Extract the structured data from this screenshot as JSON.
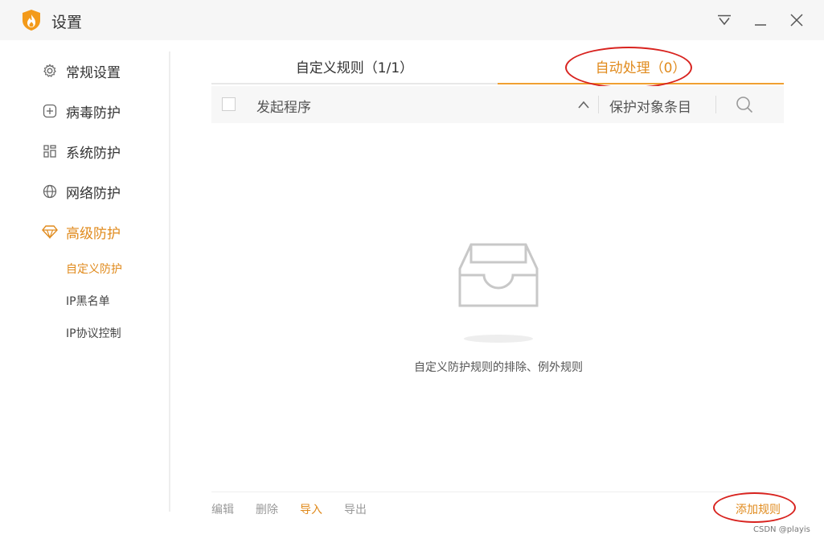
{
  "window": {
    "title": "设置",
    "logo_icon": "fire-shield-icon",
    "controls": [
      "dropdown-menu-icon",
      "minimize-icon",
      "close-icon"
    ]
  },
  "sidebar": {
    "items": [
      {
        "label": "常规设置",
        "icon": "gear-icon"
      },
      {
        "label": "病毒防护",
        "icon": "plus-square-icon"
      },
      {
        "label": "系统防护",
        "icon": "grid-icon"
      },
      {
        "label": "网络防护",
        "icon": "globe-icon"
      },
      {
        "label": "高级防护",
        "icon": "diamond-icon",
        "active": true
      }
    ],
    "sub_items": [
      {
        "label": "自定义防护",
        "active": true
      },
      {
        "label": "IP黑名单"
      },
      {
        "label": "IP协议控制"
      }
    ]
  },
  "tabs": [
    {
      "label": "自定义规则（1/1）",
      "active": false
    },
    {
      "label": "自动处理（0）",
      "active": true
    }
  ],
  "table": {
    "columns": [
      "发起程序",
      "保护对象条目"
    ],
    "sort_icon": "chevron-up-icon",
    "search_icon": "search-icon",
    "rows": []
  },
  "empty_state": {
    "icon": "empty-inbox-icon",
    "text": "自定义防护规则的排除、例外规则"
  },
  "footer": {
    "actions": [
      "编辑",
      "删除",
      "导入",
      "导出"
    ],
    "add_rule": "添加规则"
  },
  "watermark": "CSDN @playis",
  "colors": {
    "accent": "#e08a1c",
    "annotation_red": "#d8231f",
    "titlebar_bg": "#f6f6f6"
  }
}
